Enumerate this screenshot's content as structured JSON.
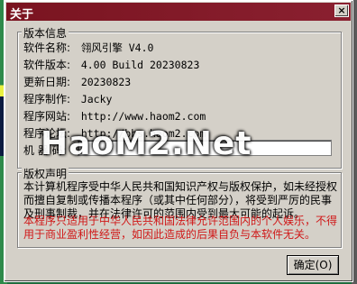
{
  "window": {
    "title": "关于"
  },
  "close_label": "×",
  "info": {
    "group_title": "版本信息",
    "rows": [
      {
        "label": "软件名称:",
        "value": "翎风引擎 V4.0"
      },
      {
        "label": "软件版本:",
        "value": "4.00 Build 20230823"
      },
      {
        "label": "更新日期:",
        "value": "20230823"
      },
      {
        "label": "程序制作:",
        "value": "Jacky"
      },
      {
        "label": "程序网站:",
        "value": "http://www.haom2.com"
      },
      {
        "label": "程序论坛:",
        "value": "http://bbs.haom2.com"
      },
      {
        "label": "机  器  码:",
        "value": ""
      }
    ]
  },
  "watermark": "HaoM2.Net",
  "copyright": {
    "group_title": "版权声明",
    "notice_black": "本计算机程序受中华人民共和国知识产权与版权保护，如未经授权而擅自复制或传播本程序（或其中任何部分），将受到严厉的民事及刑事制裁，并在法律许可的范围内受到最大可能的起诉。",
    "notice_red": "本程序只适用于中华人民共和国法律允许范围内的个人娱乐，不得用于商业盈利性经营，如因此造成的后果自负与本软件无关。"
  },
  "ok_label": "确定(O)"
}
